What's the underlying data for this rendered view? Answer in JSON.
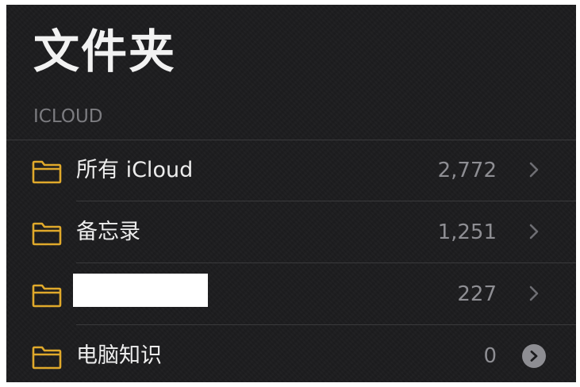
{
  "header": {
    "title": "文件夹"
  },
  "section": {
    "label": "ICLOUD"
  },
  "folders": [
    {
      "name": "所有 iCloud",
      "count": "2,772",
      "accessory": "chevron-icon"
    },
    {
      "name": "备忘录",
      "count": "1,251",
      "accessory": "chevron-icon"
    },
    {
      "name": "",
      "count": "227",
      "accessory": "chevron-icon",
      "redacted": true
    },
    {
      "name": "电脑知识",
      "count": "0",
      "accessory": "disclosure-icon"
    }
  ],
  "colors": {
    "background": "#1c1c1e",
    "folder_icon": "#e0a92b",
    "text_primary": "#ededed",
    "text_secondary": "#8e8e93",
    "separator": "#3a3a3c"
  }
}
